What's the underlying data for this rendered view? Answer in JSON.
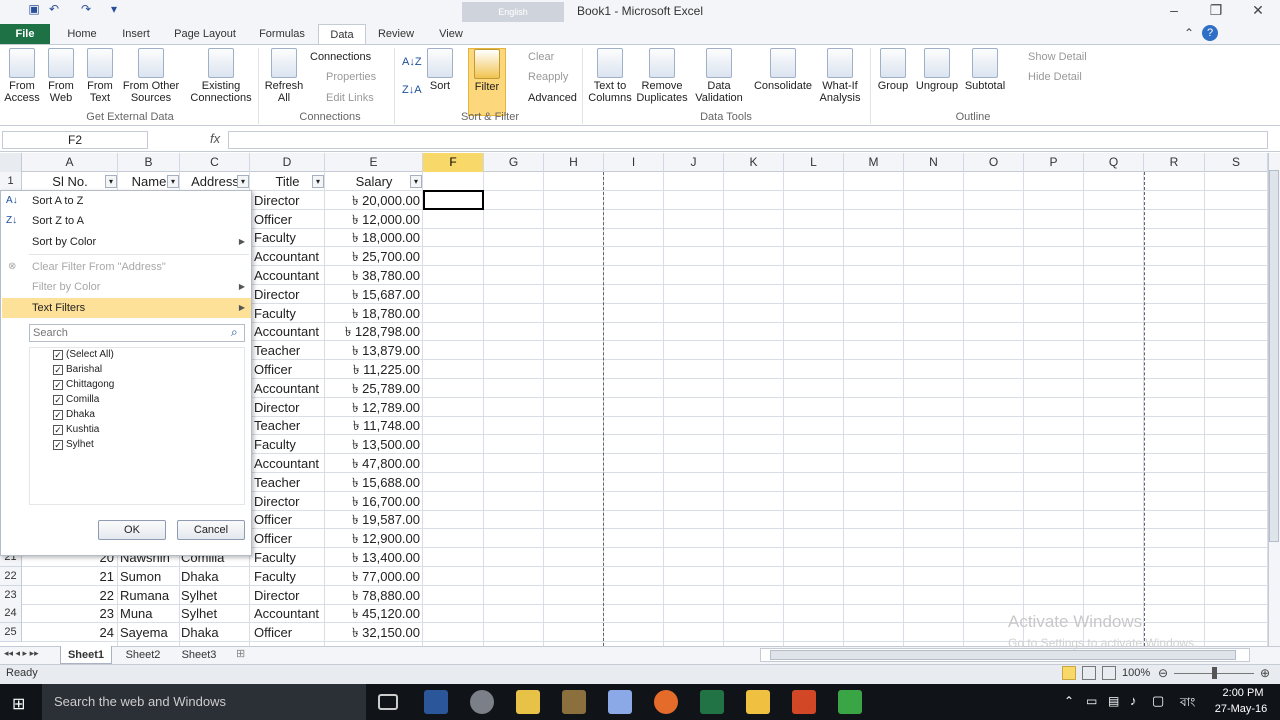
{
  "window": {
    "title": "Book1 - Microsoft Excel",
    "lang_badge": "English"
  },
  "tabs": [
    "File",
    "Home",
    "Insert",
    "Page Layout",
    "Formulas",
    "Data",
    "Review",
    "View"
  ],
  "ribbon": {
    "get_external": {
      "from_access": "From Access",
      "from_web": "From Web",
      "from_text": "From Text",
      "from_other": "From Other Sources",
      "existing": "Existing Connections",
      "label": "Get External Data"
    },
    "connections": {
      "refresh": "Refresh All",
      "connections": "Connections",
      "properties": "Properties",
      "edit_links": "Edit Links",
      "label": "Connections"
    },
    "sort_filter": {
      "sort": "Sort",
      "filter": "Filter",
      "clear": "Clear",
      "reapply": "Reapply",
      "advanced": "Advanced",
      "label": "Sort & Filter"
    },
    "data_tools": {
      "text_to_columns": "Text to Columns",
      "remove_duplicates": "Remove Duplicates",
      "data_validation": "Data Validation",
      "consolidate": "Consolidate",
      "what_if": "What-If Analysis",
      "label": "Data Tools"
    },
    "outline": {
      "group": "Group",
      "ungroup": "Ungroup",
      "subtotal": "Subtotal",
      "show_detail": "Show Detail",
      "hide_detail": "Hide Detail",
      "label": "Outline"
    }
  },
  "formula_bar": {
    "name_box": "F2",
    "fx": "fx",
    "value": ""
  },
  "columns": [
    "A",
    "B",
    "C",
    "D",
    "E",
    "F",
    "G",
    "H",
    "I",
    "J",
    "K",
    "L",
    "M",
    "N",
    "O",
    "P",
    "Q",
    "R",
    "S"
  ],
  "headers": {
    "a": "Sl No.",
    "b": "Name",
    "c": "Address",
    "d": "Title",
    "e": "Salary"
  },
  "visible_rows": [
    {
      "d": "Director",
      "e": "৳ 20,000.00"
    },
    {
      "d": "Officer",
      "e": "৳ 12,000.00"
    },
    {
      "d": "Faculty",
      "e": "৳ 18,000.00"
    },
    {
      "d": "Accountant",
      "e": "৳ 25,700.00"
    },
    {
      "d": "Accountant",
      "e": "৳ 38,780.00"
    },
    {
      "d": "Director",
      "e": "৳ 15,687.00"
    },
    {
      "d": "Faculty",
      "e": "৳ 18,780.00"
    },
    {
      "d": "Accountant",
      "e": "৳ 128,798.00"
    },
    {
      "d": "Teacher",
      "e": "৳ 13,879.00"
    },
    {
      "d": "Officer",
      "e": "৳ 11,225.00"
    },
    {
      "d": "Accountant",
      "e": "৳ 25,789.00"
    },
    {
      "d": "Director",
      "e": "৳ 12,789.00"
    },
    {
      "d": "Teacher",
      "e": "৳ 11,748.00"
    },
    {
      "d": "Faculty",
      "e": "৳ 13,500.00"
    },
    {
      "d": "Accountant",
      "e": "৳ 47,800.00"
    },
    {
      "d": "Teacher",
      "e": "৳ 15,688.00"
    },
    {
      "d": "Director",
      "e": "৳ 16,700.00"
    },
    {
      "d": "Officer",
      "e": "৳ 19,587.00"
    },
    {
      "d": "Officer",
      "e": "৳ 12,900.00"
    }
  ],
  "full_rows": [
    {
      "row": "21",
      "a": "20",
      "b": "Nawshin",
      "c": "Comilla",
      "d": "Faculty",
      "e": "৳ 13,400.00"
    },
    {
      "row": "22",
      "a": "21",
      "b": "Sumon",
      "c": "Dhaka",
      "d": "Faculty",
      "e": "৳ 77,000.00"
    },
    {
      "row": "23",
      "a": "22",
      "b": "Rumana",
      "c": "Sylhet",
      "d": "Director",
      "e": "৳ 78,880.00"
    },
    {
      "row": "24",
      "a": "23",
      "b": "Muna",
      "c": "Sylhet",
      "d": "Accountant",
      "e": "৳ 45,120.00"
    },
    {
      "row": "25",
      "a": "24",
      "b": "Sayema",
      "c": "Dhaka",
      "d": "Officer",
      "e": "৳ 32,150.00"
    }
  ],
  "filter_menu": {
    "sort_az": "Sort A to Z",
    "sort_za": "Sort Z to A",
    "sort_color": "Sort by Color",
    "clear_filter": "Clear Filter From \"Address\"",
    "filter_color": "Filter by Color",
    "text_filters": "Text Filters",
    "search_placeholder": "Search",
    "items": [
      "(Select All)",
      "Barishal",
      "Chittagong",
      "Comilla",
      "Dhaka",
      "Kushtia",
      "Sylhet"
    ],
    "ok": "OK",
    "cancel": "Cancel"
  },
  "sheets": [
    "Sheet1",
    "Sheet2",
    "Sheet3"
  ],
  "status": {
    "ready": "Ready",
    "zoom": "100%"
  },
  "watermark": {
    "line1": "Activate Windows",
    "line2": "Go to Settings to activate Windows."
  },
  "taskbar": {
    "search": "Search the web and Windows",
    "time": "2:00 PM",
    "date": "27-May-16",
    "lang": "বাং"
  }
}
